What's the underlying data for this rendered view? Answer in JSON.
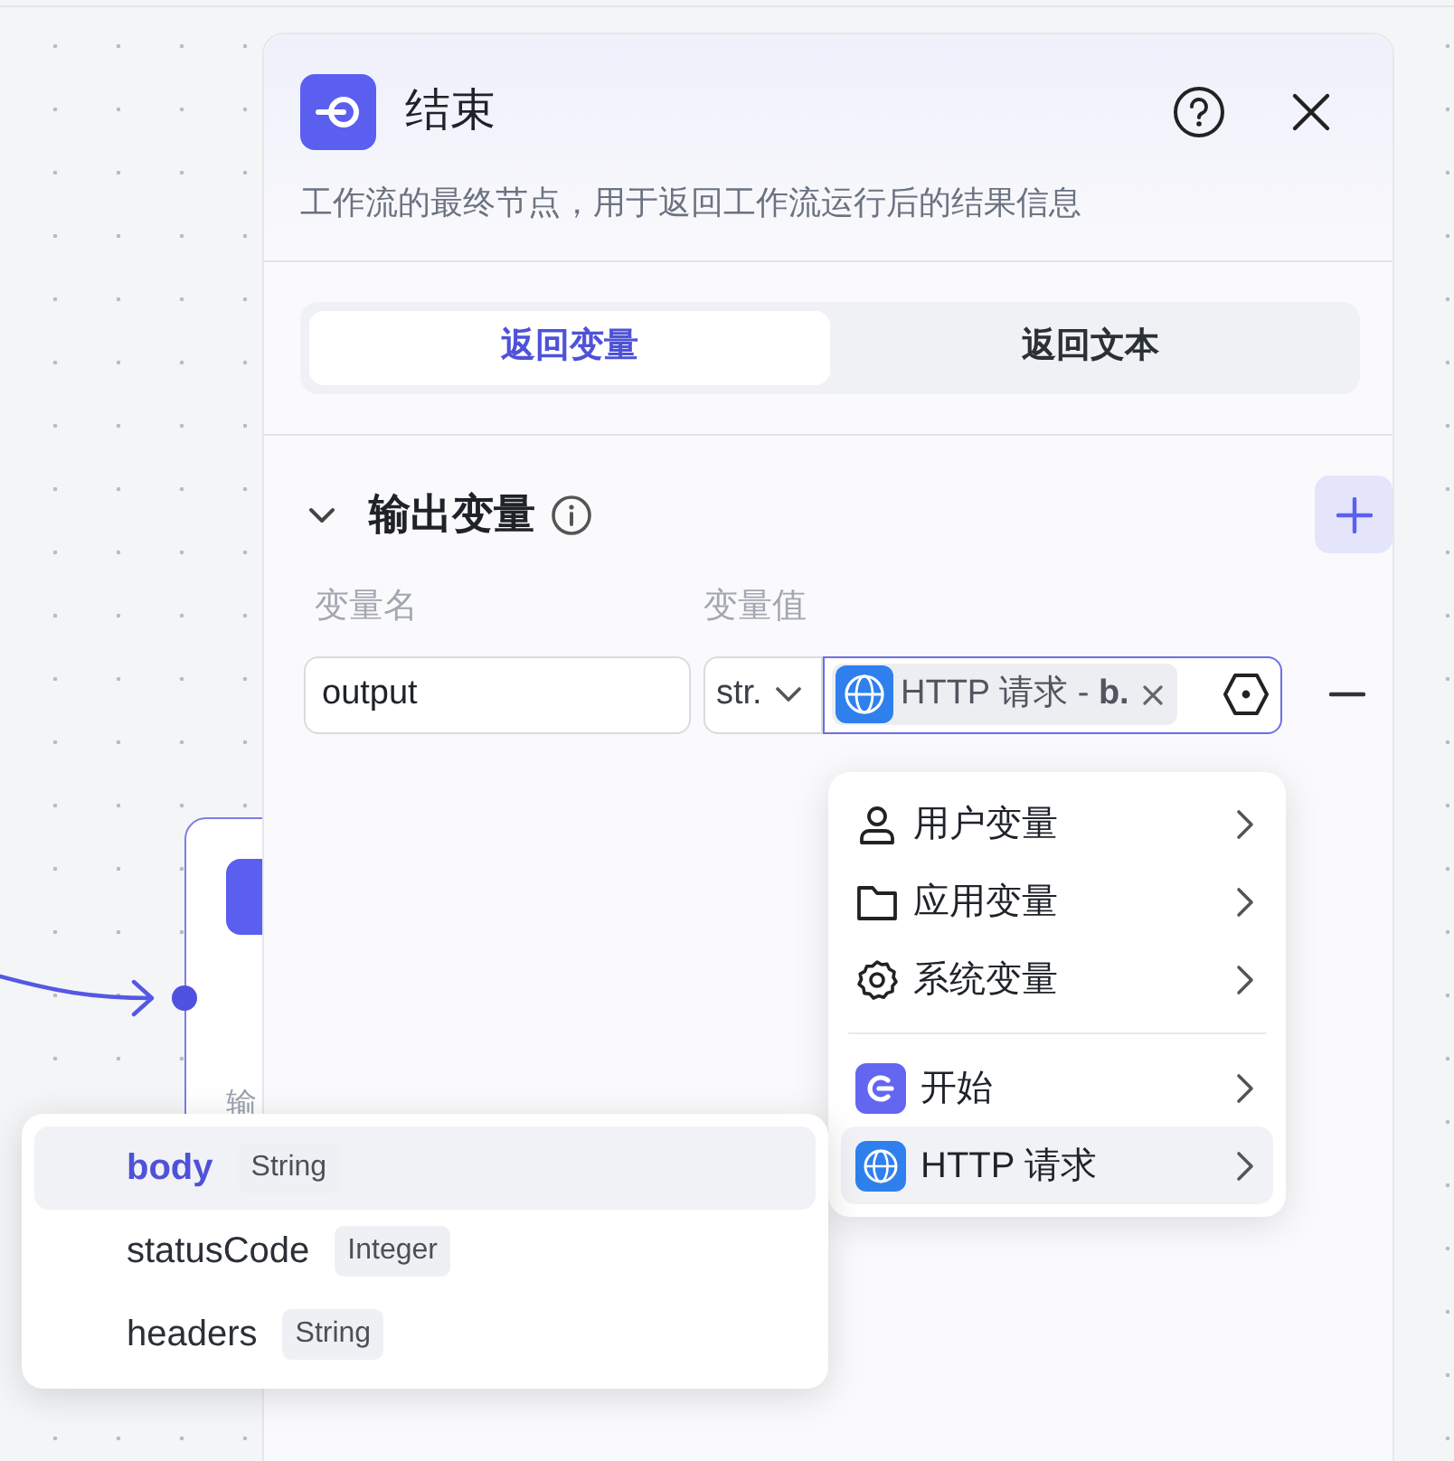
{
  "canvas_node": {
    "label": "输"
  },
  "panel": {
    "title": "结束",
    "description": "工作流的最终节点，用于返回工作流运行后的结果信息",
    "tabs": [
      {
        "label": "返回变量",
        "selected": true
      },
      {
        "label": "返回文本",
        "selected": false
      }
    ],
    "section": {
      "title": "输出变量",
      "expanded": true,
      "columns": [
        "变量名",
        "变量值"
      ],
      "rows": [
        {
          "name": "output",
          "type": "str.",
          "value": "HTTP 请求 - **b.**"
        }
      ]
    }
  },
  "variable_menu": {
    "items": [
      {
        "label": "用户变量",
        "kind": "user",
        "selected": false
      },
      {
        "label": "应用变量",
        "kind": "app",
        "selected": false
      },
      {
        "label": "系统变量",
        "kind": "system",
        "selected": false
      },
      {
        "label": "开始",
        "kind": "start",
        "selected": false
      },
      {
        "label": "HTTP 请求",
        "kind": "http",
        "selected": true
      }
    ]
  },
  "field_menu": {
    "items": [
      {
        "name": "body",
        "type": "String",
        "selected": true
      },
      {
        "name": "statusCode",
        "type": "Integer",
        "selected": false
      },
      {
        "name": "headers",
        "type": "String",
        "selected": false
      }
    ]
  }
}
